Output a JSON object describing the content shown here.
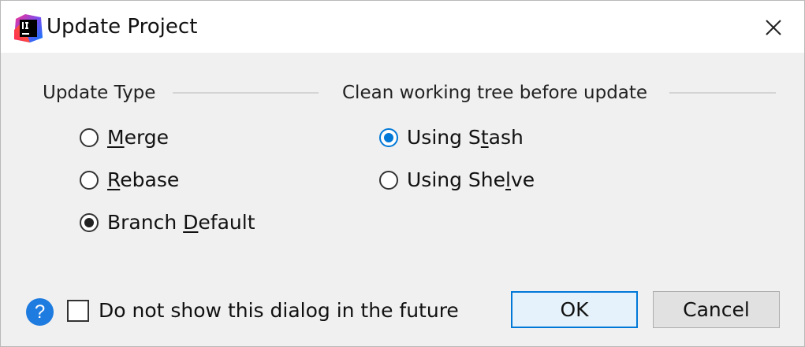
{
  "window": {
    "title": "Update Project",
    "app_icon": "intellij-idea-icon",
    "close_icon": "close-icon"
  },
  "update_type": {
    "label": "Update Type",
    "options": [
      {
        "pre": "",
        "mnemonic": "M",
        "post": "erge",
        "checked": false
      },
      {
        "pre": "",
        "mnemonic": "R",
        "post": "ebase",
        "checked": false
      },
      {
        "pre": "Branch ",
        "mnemonic": "D",
        "post": "efault",
        "checked": true
      }
    ]
  },
  "clean_tree": {
    "label": "Clean working tree before update",
    "options": [
      {
        "pre": "Using S",
        "mnemonic": "t",
        "post": "ash",
        "checked": true
      },
      {
        "pre": "Using She",
        "mnemonic": "l",
        "post": "ve",
        "checked": false
      }
    ]
  },
  "footer": {
    "help_icon": "help-icon",
    "help_glyph": "?",
    "dont_show_label": "Do not show this dialog in the future",
    "dont_show_checked": false,
    "ok_label": "OK",
    "cancel_label": "Cancel"
  },
  "colors": {
    "accent": "#0078d7",
    "help_blue": "#1e7be0",
    "ok_bg": "#e5f1fb"
  }
}
